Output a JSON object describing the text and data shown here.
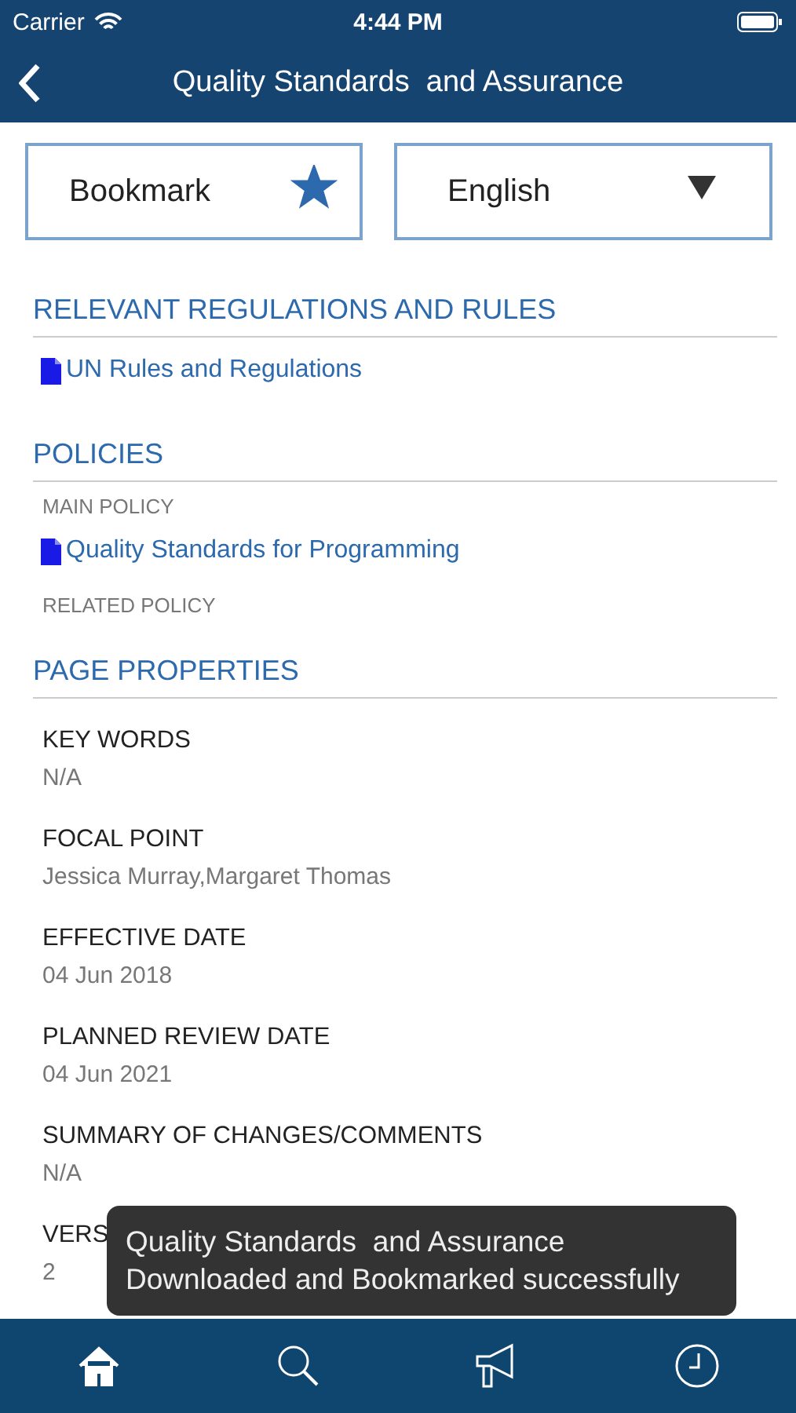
{
  "status_bar": {
    "carrier": "Carrier",
    "time": "4:44 PM"
  },
  "nav_bar": {
    "title": "Quality Standards  and Assurance"
  },
  "bookmark_button": {
    "label": "Bookmark",
    "bookmarked": true
  },
  "language_select": {
    "value": "English"
  },
  "sections": [
    {
      "title": "RELEVANT REGULATIONS AND RULES",
      "items": [
        {
          "kind": "link",
          "text": "UN Rules and Regulations"
        }
      ]
    },
    {
      "title": "POLICIES",
      "items": [
        {
          "kind": "label",
          "text": "MAIN POLICY"
        },
        {
          "kind": "link",
          "text": "Quality Standards for Programming"
        },
        {
          "kind": "label",
          "text": "RELATED POLICY"
        }
      ]
    },
    {
      "title": "PAGE PROPERTIES",
      "items": [
        {
          "kind": "property",
          "label": "KEY WORDS",
          "value": "N/A"
        },
        {
          "kind": "property",
          "label": "FOCAL POINT",
          "value": "Jessica Murray,Margaret Thomas"
        },
        {
          "kind": "property",
          "label": "EFFECTIVE DATE",
          "value": "04 Jun 2018"
        },
        {
          "kind": "property",
          "label": "PLANNED REVIEW DATE",
          "value": "04 Jun 2021"
        },
        {
          "kind": "property",
          "label": "SUMMARY OF CHANGES/COMMENTS",
          "value": "N/A"
        },
        {
          "kind": "property",
          "label": "VERS",
          "value": "2"
        }
      ]
    }
  ],
  "toast": {
    "lines": [
      "Quality Standards  and Assurance",
      "Downloaded and Bookmarked successfully"
    ]
  },
  "tab_bar": [
    {
      "kind": "home",
      "selected": true
    },
    {
      "kind": "search",
      "selected": false
    },
    {
      "kind": "megaphone",
      "selected": false
    },
    {
      "kind": "clock",
      "selected": false
    }
  ]
}
